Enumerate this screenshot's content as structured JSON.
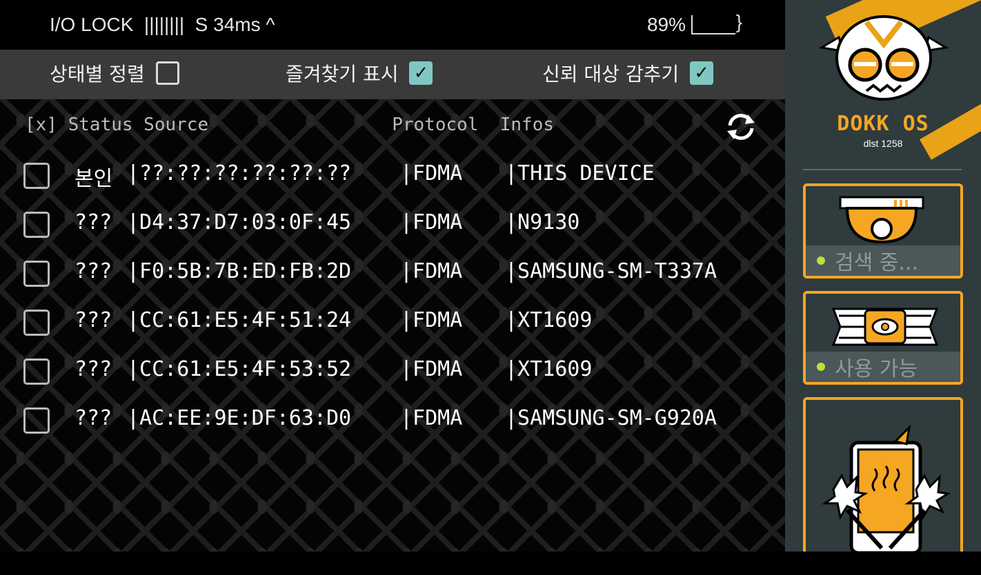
{
  "statusbar": {
    "left": "I/O LOCK  ||||||||  S 34ms ^",
    "battery": "89%"
  },
  "filters": [
    {
      "label": "상태별 정렬",
      "checked": false
    },
    {
      "label": "즐겨찾기 표시",
      "checked": true
    },
    {
      "label": "신뢰 대상 감추기",
      "checked": true
    }
  ],
  "list": {
    "header": "[x] Status Source                 Protocol  Infos",
    "rows": [
      {
        "status": "본인",
        "source": "|??:??:??:??:??:??",
        "protocol": "|FDMA",
        "info": "|THIS DEVICE"
      },
      {
        "status": "???",
        "source": "|D4:37:D7:03:0F:45",
        "protocol": "|FDMA",
        "info": "|N9130"
      },
      {
        "status": "???",
        "source": "|F0:5B:7B:ED:FB:2D",
        "protocol": "|FDMA",
        "info": "|SAMSUNG-SM-T337A"
      },
      {
        "status": "???",
        "source": "|CC:61:E5:4F:51:24",
        "protocol": "|FDMA",
        "info": "|XT1609"
      },
      {
        "status": "???",
        "source": "|CC:61:E5:4F:53:52",
        "protocol": "|FDMA",
        "info": "|XT1609"
      },
      {
        "status": "???",
        "source": "|AC:EE:9E:DF:63:D0",
        "protocol": "|FDMA",
        "info": "|SAMSUNG-SM-G920A"
      }
    ]
  },
  "sidebar": {
    "brand": "DOKK OS",
    "sub": "dlst 1258",
    "cards": [
      {
        "icon": "camera-icon",
        "status": "검색 중..."
      },
      {
        "icon": "eye-icon",
        "status": "사용 가능"
      },
      {
        "icon": "phone-smash-icon",
        "status": ""
      }
    ]
  },
  "colors": {
    "accent": "#f5a623",
    "check": "#7fc8c2",
    "sidebar": "#2f3b3d"
  }
}
